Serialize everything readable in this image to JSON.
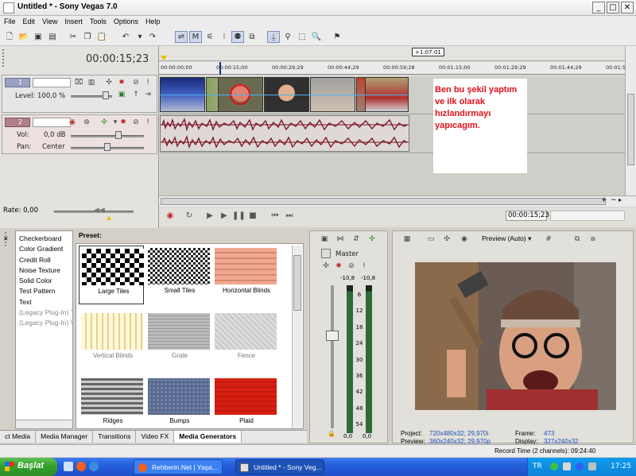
{
  "window": {
    "title": "Untitled * - Sony Vegas 7.0",
    "min": "_",
    "max": "□",
    "close": "✕"
  },
  "menu": [
    "File",
    "Edit",
    "View",
    "Insert",
    "Tools",
    "Options",
    "Help"
  ],
  "timeline": {
    "cursor_time": "00:00:15;23",
    "marker": "+1:07:01",
    "ruler_ticks": [
      "00:00:00;00",
      "00:00:15;00",
      "00:00:29;29",
      "00:00:44;29",
      "00:00:59;28",
      "00:01:15;00",
      "00:01:29;29",
      "00:01:44;29",
      "00:01:5"
    ],
    "note_lines": [
      "Ben bu şekil yaptım",
      "ve ilk olarak",
      "hızlandırmayı",
      "yapıcagım."
    ]
  },
  "tracks": {
    "video": {
      "number": "1",
      "level_label": "Level:",
      "level_value": "100,0 %"
    },
    "audio": {
      "number": "2",
      "vol_label": "Vol:",
      "vol_value": "0,0 dB",
      "pan_label": "Pan:",
      "pan_value": "Center"
    }
  },
  "transport": {
    "rate_label": "Rate:",
    "rate_value": "0,00",
    "time": "00:00:15;23"
  },
  "generators": [
    "Checkerboard",
    "Color Gradient",
    "Credit Roll",
    "Noise Texture",
    "Solid Color",
    "Test Pattern",
    "Text",
    "(Legacy Plug-In) T",
    "(Legacy Plug-In) V"
  ],
  "presets": {
    "label": "Preset:",
    "items": [
      "Large Tiles",
      "Small Tiles",
      "Horizontal Blinds",
      "Vertical Blinds",
      "Grate",
      "Fence",
      "Ridges",
      "Bumps",
      "Plaid"
    ]
  },
  "tabs": [
    "ct Media",
    "Media Manager",
    "Transitions",
    "Video FX",
    "Media Generators"
  ],
  "mixer": {
    "label": "Master",
    "left_db": "-10,8",
    "right_db": "-10,8",
    "scale": [
      "6",
      "12",
      "18",
      "24",
      "30",
      "36",
      "42",
      "48",
      "54"
    ],
    "left_out": "0,0",
    "right_out": "0,0"
  },
  "preview": {
    "mode": "Preview (Auto)",
    "project_label": "Project:",
    "project_value": "720x480x32; 29,970i",
    "preview_label": "Preview:",
    "preview_value": "360x240x32; 29,970p",
    "frame_label": "Frame:",
    "frame_value": "473",
    "display_label": "Display:",
    "display_value": "327x240x32"
  },
  "status": {
    "record_time": "Record Time (2 channels): 09:24:40"
  },
  "taskbar": {
    "start": "Başlat",
    "items": [
      "Rehberin.Net | Yaşa...",
      "Untitled * - Sony Veg..."
    ],
    "lang": "TR",
    "clock": "17:25"
  },
  "colors": {
    "note_text": "#e0101a",
    "waveform": "#7a1020",
    "preview_value": "#2050c0",
    "selected_region": "#ffffff"
  }
}
